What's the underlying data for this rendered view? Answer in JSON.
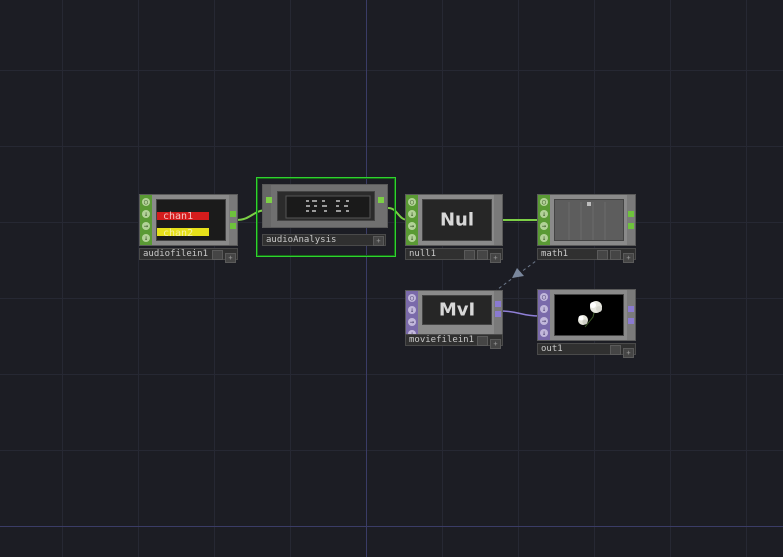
{
  "network": {
    "nodes": [
      {
        "id": "audiofilein1",
        "label": "audiofilein1",
        "family": "CHOP"
      },
      {
        "id": "audioAnalysis",
        "label": "audioAnalysis",
        "family": "COMP",
        "selected": true
      },
      {
        "id": "null1",
        "label": "null1",
        "family": "CHOP",
        "viewer_text": "Nul"
      },
      {
        "id": "math1",
        "label": "math1",
        "family": "CHOP"
      },
      {
        "id": "moviefilein1",
        "label": "moviefilein1",
        "family": "TOP",
        "viewer_text": "MvI"
      },
      {
        "id": "out1",
        "label": "out1",
        "family": "TOP"
      }
    ],
    "audio_channels": [
      "chan1",
      "chan2"
    ],
    "colors": {
      "background": "#1c1d24",
      "chop": "#5a9a34",
      "chop_wire": "#7ccf46",
      "top": "#7a6aaa",
      "top_wire": "#8f7fd6",
      "selection": "#2fd22f"
    }
  }
}
